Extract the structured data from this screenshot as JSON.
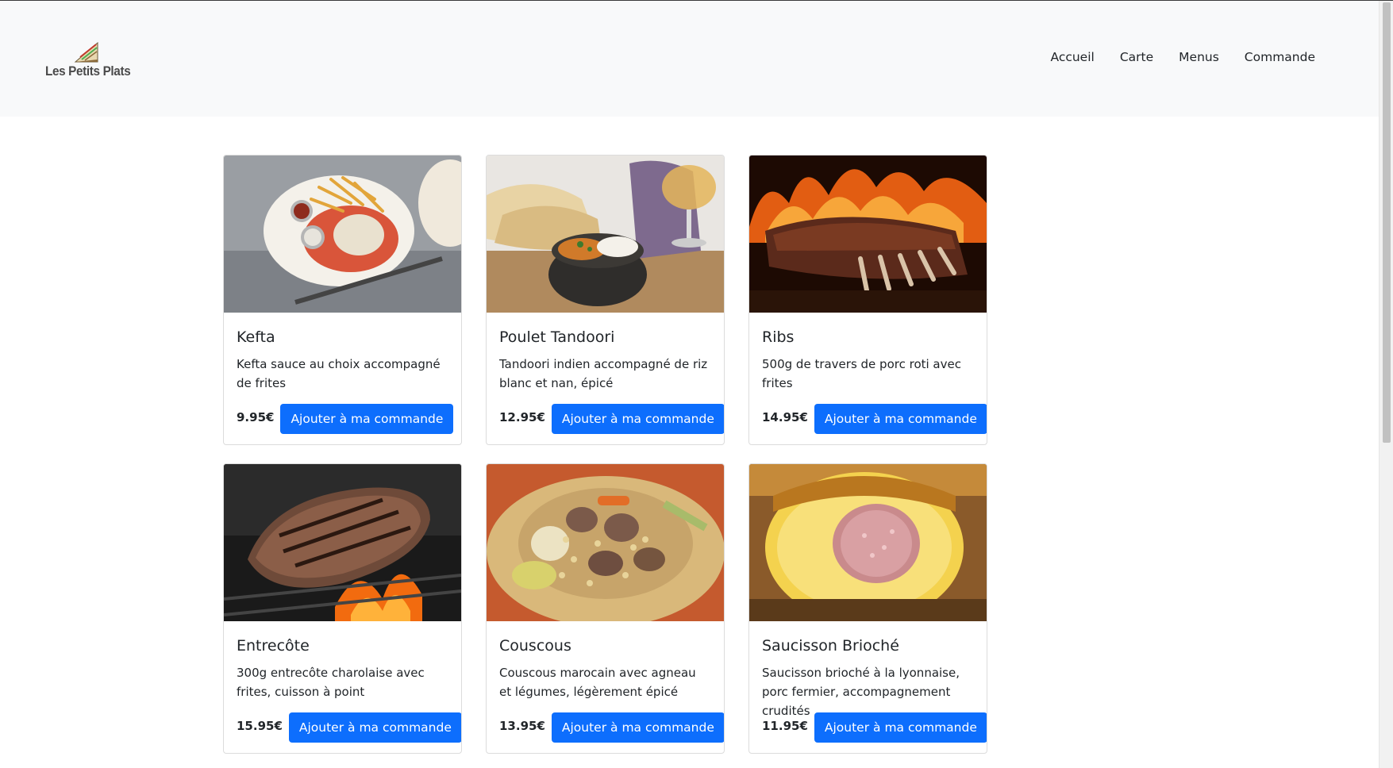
{
  "brand": {
    "name": "Les Petits Plats"
  },
  "nav": {
    "items": [
      "Accueil",
      "Carte",
      "Menus",
      "Commande"
    ]
  },
  "button_label": "Ajouter à ma commande",
  "dishes": [
    {
      "title": "Kefta",
      "description": "Kefta sauce au choix accompagné de frites",
      "price": "9.95€",
      "image": "kefta-photo"
    },
    {
      "title": "Poulet Tandoori",
      "description": "Tandoori indien accompagné de riz blanc et nan, épicé",
      "price": "12.95€",
      "image": "tandoori-photo"
    },
    {
      "title": "Ribs",
      "description": "500g de travers de porc roti avec frites",
      "price": "14.95€",
      "image": "ribs-photo"
    },
    {
      "title": "Entrecôte",
      "description": "300g entrecôte charolaise avec frites, cuisson à point",
      "price": "15.95€",
      "image": "entrecote-photo"
    },
    {
      "title": "Couscous",
      "description": "Couscous marocain avec agneau et légumes, légèrement épicé",
      "price": "13.95€",
      "image": "couscous-photo"
    },
    {
      "title": "Saucisson Brioché",
      "description": "Saucisson brioché à la lyonnaise, porc fermier, accompagnement crudités",
      "price": "11.95€",
      "image": "saucisson-photo"
    }
  ],
  "colors": {
    "accent": "#0d6efd",
    "navbar_bg": "#f8f9fa"
  }
}
